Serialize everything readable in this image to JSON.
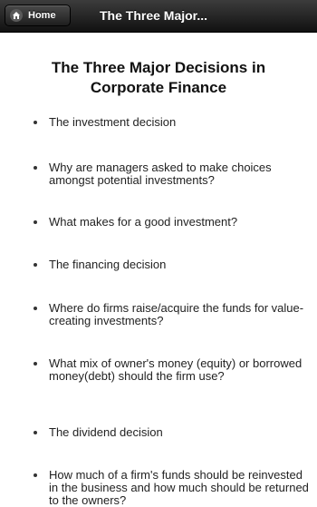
{
  "header": {
    "home_label": "Home",
    "title": "The Three Major..."
  },
  "page": {
    "title": "The Three Major Decisions in Corporate Finance",
    "items": [
      "The investment decision",
      "Why are managers asked to make choices amongst potential investments?",
      "What makes for a good investment?",
      "The financing decision",
      "Where do firms raise/acquire the funds for value-creating investments?",
      "What mix of owner's money (equity) or borrowed money(debt) should the firm use?",
      "The dividend decision",
      "How much of a firm's funds should be reinvested in the business and how much should be returned to the owners?"
    ]
  },
  "icons": {
    "home": "home-icon"
  }
}
